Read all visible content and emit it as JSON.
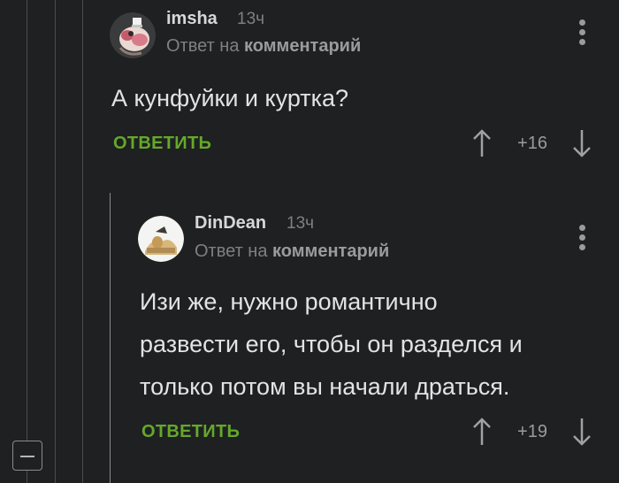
{
  "comments": [
    {
      "username": "imsha",
      "time": "13ч",
      "reply_prefix": "Ответ на",
      "reply_link": "комментарий",
      "body": [
        "А кунфуйки и куртка?"
      ],
      "reply_action": "ОТВЕТИТЬ",
      "rating": "+16"
    },
    {
      "username": "DinDean",
      "time": "13ч",
      "reply_prefix": "Ответ на",
      "reply_link": "комментарий",
      "body": [
        "Изи же, нужно романтично",
        "развести его, чтобы он разделся и",
        "только потом вы начали драться."
      ],
      "reply_action": "ОТВЕТИТЬ",
      "rating": "+19"
    }
  ],
  "icons": {
    "collapse": "minus-icon",
    "menu": "more-vertical-icon",
    "upvote": "arrow-up-icon",
    "downvote": "arrow-down-icon"
  },
  "colors": {
    "background": "#1f2021",
    "accent": "#64a82c",
    "text": "#e2e3e4",
    "muted": "#7f8081"
  }
}
